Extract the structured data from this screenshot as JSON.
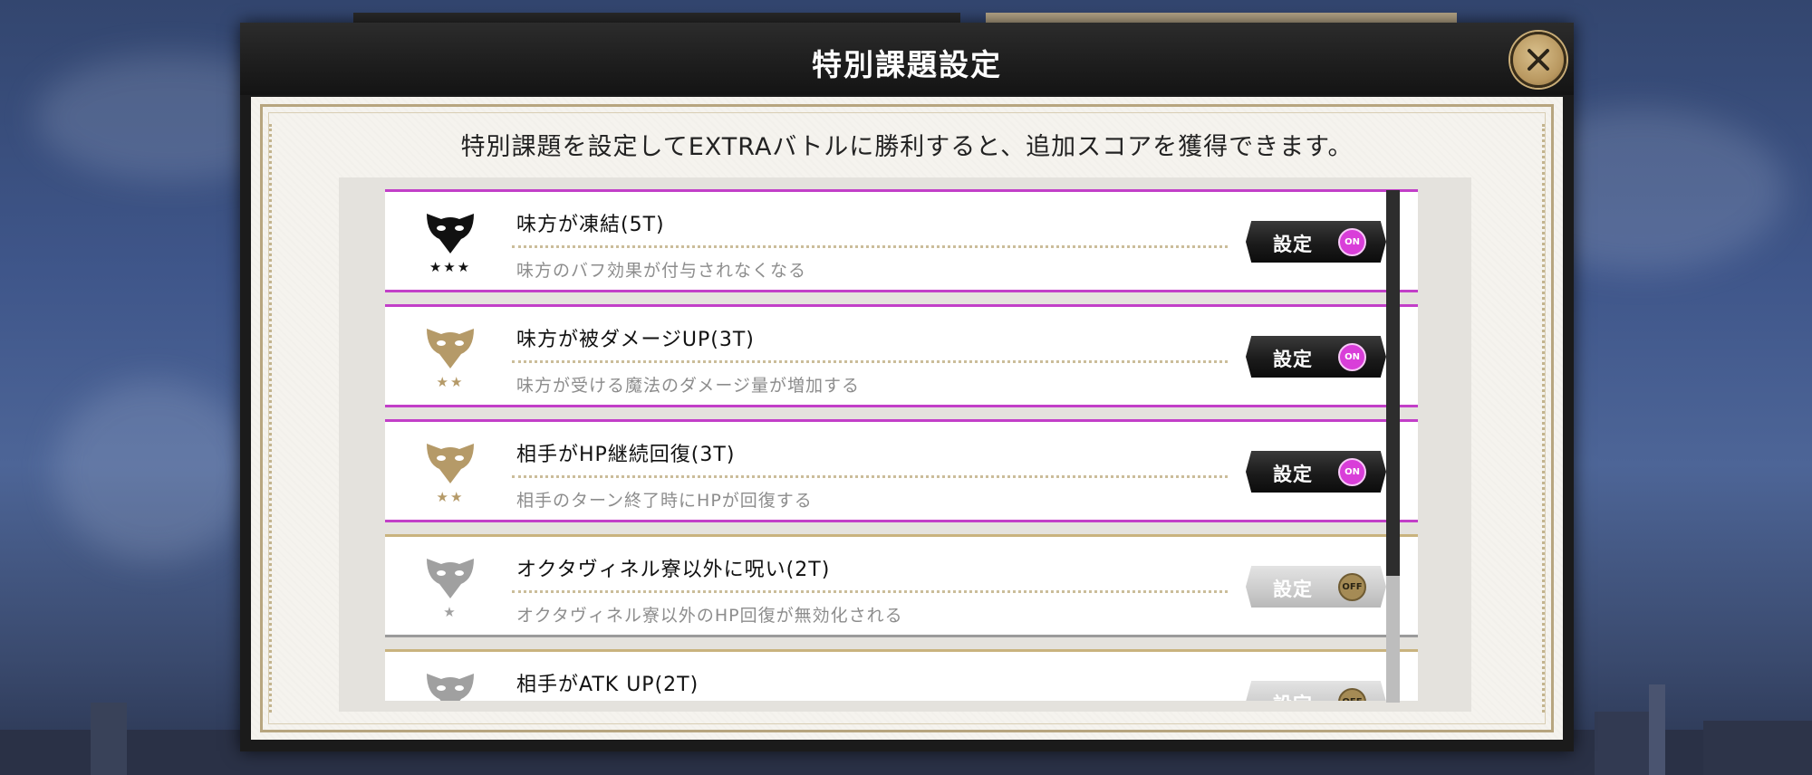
{
  "modal": {
    "title": "特別課題設定",
    "close_icon": "close-icon",
    "subtitle": "特別課題を設定してEXTRAバトルに勝利すると、追加スコアを獲得できます。"
  },
  "colors": {
    "on_accent": "#c23fc8",
    "off_accent": "#c9b37e",
    "gold": "#b8975f",
    "dark": "#1b1b1b"
  },
  "tasks": [
    {
      "name": "味方が凍結(5T)",
      "desc": "味方のバフ効果が付与されなくなる",
      "stars": "★★★",
      "icon": "mask-icon-black",
      "button": "設定",
      "toggle": "ON",
      "state": "on"
    },
    {
      "name": "味方が被ダメージUP(3T)",
      "desc": "味方が受ける魔法のダメージ量が増加する",
      "stars": "★★",
      "icon": "mask-icon-gold",
      "button": "設定",
      "toggle": "ON",
      "state": "on"
    },
    {
      "name": "相手がHP継続回復(3T)",
      "desc": "相手のターン終了時にHPが回復する",
      "stars": "★★",
      "icon": "mask-icon-gold",
      "button": "設定",
      "toggle": "ON",
      "state": "on"
    },
    {
      "name": "オクタヴィネル寮以外に呪い(2T)",
      "desc": "オクタヴィネル寮以外のHP回復が無効化される",
      "stars": "★",
      "icon": "mask-icon-gray",
      "button": "設定",
      "toggle": "OFF",
      "state": "off"
    },
    {
      "name": "相手がATK UP(2T)",
      "desc": "",
      "stars": "",
      "icon": "mask-icon-gray",
      "button": "設定",
      "toggle": "OFF",
      "state": "off"
    }
  ]
}
